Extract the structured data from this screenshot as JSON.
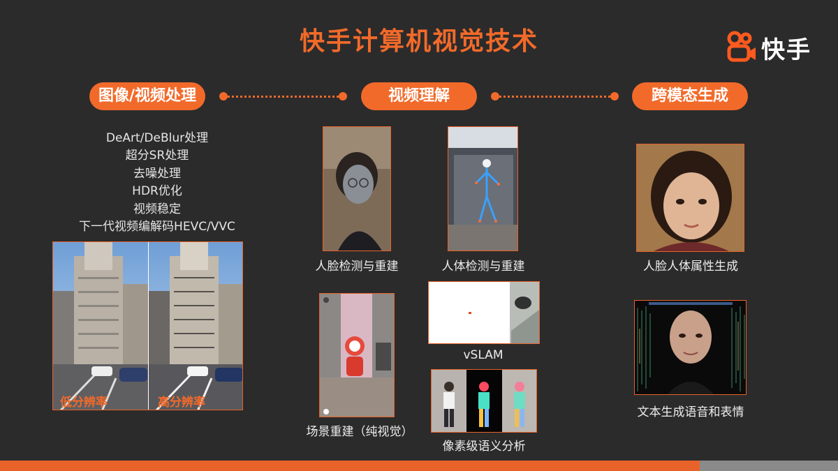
{
  "title": "快手计算机视觉技术",
  "logo": {
    "text": "快手",
    "icon": "kuaishou-logo-icon",
    "color": "#ff5a1f"
  },
  "colors": {
    "accent": "#f26a2a",
    "background": "#2b2b2b",
    "bar_orange": "#e8622a",
    "bar_gray": "#8a8a8a"
  },
  "categories": [
    {
      "label": "图像/视频处理"
    },
    {
      "label": "视频理解"
    },
    {
      "label": "跨模态生成"
    }
  ],
  "processing_list": [
    "DeArt/DeBlur处理",
    "超分SR处理",
    "去噪处理",
    "HDR优化",
    "视频稳定",
    "下一代视频编解码HEVC/VVC"
  ],
  "resolution_demo": {
    "low_label": "低分辨率",
    "high_label": "高分辨率"
  },
  "understanding": {
    "face_caption": "人脸检测与重建",
    "body_caption": "人体检测与重建",
    "scene_caption": "场景重建（纯视觉）",
    "vslam_caption": "vSLAM",
    "parsing_caption": "像素级语义分析"
  },
  "generation": {
    "attr_caption": "人脸人体属性生成",
    "tts_caption": "文本生成语音和表情"
  }
}
